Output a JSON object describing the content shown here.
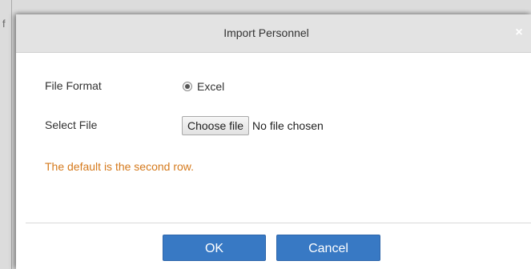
{
  "background": {
    "glyph": "f"
  },
  "dialog": {
    "title": "Import Personnel",
    "close_icon": "close-icon",
    "close_symbol": "×",
    "file_format": {
      "label": "File Format",
      "option_label": "Excel",
      "selected": true
    },
    "select_file": {
      "label": "Select File",
      "button_label": "Choose file",
      "status": "No file chosen"
    },
    "hint": "The default is the second row.",
    "buttons": {
      "ok": "OK",
      "cancel": "Cancel"
    }
  },
  "colors": {
    "titlebar": "#e3e3e3",
    "hint": "#d57a1d",
    "primary_button": "#3879c4"
  }
}
